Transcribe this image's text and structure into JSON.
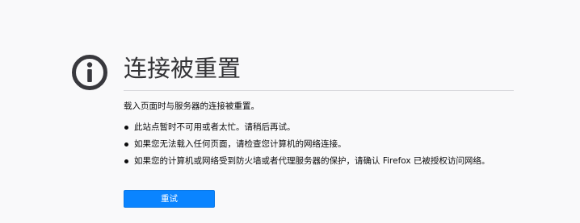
{
  "icon": "info-icon",
  "title": "连接被重置",
  "description": "载入页面时与服务器的连接被重置。",
  "suggestions": [
    "此站点暂时不可用或者太忙。请稍后再试。",
    "如果您无法载入任何页面，请检查您计算机的网络连接。",
    "如果您的计算机或网络受到防火墙或者代理服务器的保护，请确认 Firefox 已被授权访问网络。"
  ],
  "button_label": "重试",
  "colors": {
    "background": "#f9f9fa",
    "accent": "#0a84ff",
    "icon": "#38383d",
    "title": "#333336"
  }
}
